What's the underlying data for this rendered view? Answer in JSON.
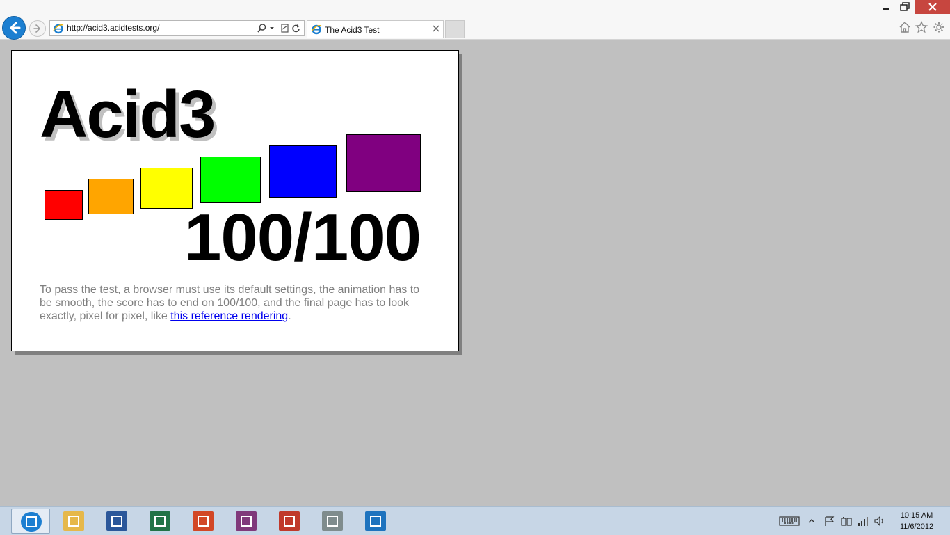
{
  "browser": {
    "address_url": "http://acid3.acidtests.org/",
    "tab_title": "The Acid3 Test"
  },
  "page": {
    "heading": "Acid3",
    "score": "100/100",
    "notice_text": "To pass the test, a browser must use its default settings, the animation has to be smooth, the score has to end on 100/100, and the final page has to look exactly, pixel for pixel, like ",
    "notice_link": "this reference rendering",
    "notice_end": ".",
    "bucket_colors": [
      "#ff0000",
      "#ffa500",
      "#ffff00",
      "#00ff00",
      "#0000ff",
      "#800080"
    ]
  },
  "taskbar": {
    "apps": [
      {
        "name": "internet-explorer-icon",
        "color": "#1c7fd1"
      },
      {
        "name": "file-explorer-icon",
        "color": "#e6b84a"
      },
      {
        "name": "word-icon",
        "color": "#2b579a"
      },
      {
        "name": "excel-icon",
        "color": "#217346"
      },
      {
        "name": "powerpoint-icon",
        "color": "#d24726"
      },
      {
        "name": "onenote-icon",
        "color": "#80397b"
      },
      {
        "name": "snipping-tool-icon",
        "color": "#c0392b"
      },
      {
        "name": "resource-monitor-icon",
        "color": "#7f8c8d"
      },
      {
        "name": "powershell-icon",
        "color": "#1e73be"
      }
    ],
    "clock_time": "10:15 AM",
    "clock_date": "11/6/2012"
  }
}
